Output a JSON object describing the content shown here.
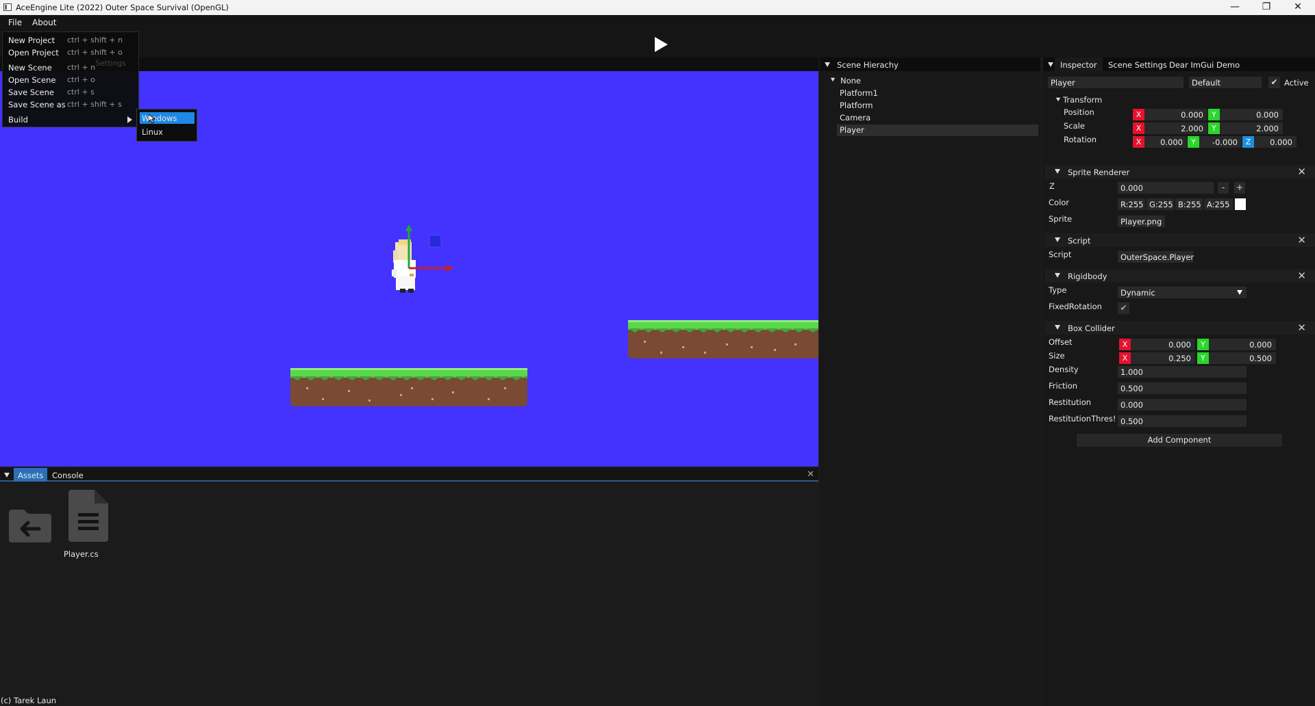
{
  "window": {
    "title": "AceEngine Lite (2022) Outer Space Survival (OpenGL)",
    "minimize": "—",
    "maximize": "❐",
    "close": "✕"
  },
  "menubar": {
    "file": "File",
    "about": "About"
  },
  "file_menu": {
    "items": [
      {
        "label": "New Project",
        "shortcut": "ctrl + shift + n"
      },
      {
        "label": "Open Project",
        "shortcut": "ctrl + shift + o"
      },
      {
        "label": "New Scene",
        "shortcut": "ctrl + n"
      },
      {
        "label": "Open Scene",
        "shortcut": "ctrl + o"
      },
      {
        "label": "Save Scene",
        "shortcut": "ctrl + s"
      },
      {
        "label": "Save Scene as",
        "shortcut": "ctrl + shift + s"
      }
    ],
    "build": "Build",
    "ghost_text": "Settings",
    "build_submenu": [
      "Windows",
      "Linux"
    ]
  },
  "hierarchy": {
    "title": "Scene Hierachy",
    "root": "None",
    "items": [
      "Platform1",
      "Platform",
      "Camera",
      "Player"
    ],
    "selected": "Player"
  },
  "inspector": {
    "tabs": [
      "Inspector",
      "Scene Settings",
      "Dear ImGui Demo"
    ],
    "name": "Player",
    "tag": "Default",
    "active_label": "Active",
    "transform": {
      "title": "Transform",
      "position_label": "Position",
      "scale_label": "Scale",
      "rotation_label": "Rotation",
      "position": {
        "x": "0.000",
        "y": "0.000"
      },
      "scale": {
        "x": "2.000",
        "y": "2.000"
      },
      "rotation": {
        "x": "0.000",
        "y": "-0.000",
        "z": "0.000"
      }
    },
    "sprite_renderer": {
      "title": "Sprite Renderer",
      "z_label": "Z",
      "z": "0.000",
      "minus": "-",
      "plus": "+",
      "color_label": "Color",
      "r": "R:255",
      "g": "G:255",
      "b": "B:255",
      "a": "A:255",
      "swatch": "#ffffff",
      "sprite_label": "Sprite",
      "sprite": "Player.png"
    },
    "script": {
      "title": "Script",
      "script_label": "Script",
      "value": "OuterSpace.Player"
    },
    "rigidbody": {
      "title": "Rigidbody",
      "type_label": "Type",
      "type": "Dynamic",
      "fixed_rotation_label": "FixedRotation"
    },
    "box_collider": {
      "title": "Box Collider",
      "offset_label": "Offset",
      "size_label": "Size",
      "offset": {
        "x": "0.000",
        "y": "0.000"
      },
      "size": {
        "x": "0.250",
        "y": "0.500"
      },
      "density_label": "Density",
      "density": "1.000",
      "friction_label": "Friction",
      "friction": "0.500",
      "restitution_label": "Restitution",
      "restitution": "0.000",
      "restitution_threshold_label": "RestitutionThres!",
      "restitution_threshold": "0.500"
    },
    "add_component": "Add Component",
    "axis": {
      "x": "X",
      "y": "Y",
      "z": "Z"
    }
  },
  "bottom_panel": {
    "tabs": [
      "Assets",
      "Console"
    ],
    "assets": [
      {
        "name": "Player.cs",
        "icon": "script-file-icon"
      }
    ],
    "back_icon": "back-folder-icon"
  },
  "status": "(c) Tarek Laun",
  "colors": {
    "viewport_bg": "#4433ff",
    "axis_x": "#e8112d",
    "axis_y": "#2bd62b",
    "axis_z": "#1e8fe0",
    "accent": "#1e88e5",
    "grass": "#5cd64a",
    "dirt": "#7a4a35"
  }
}
